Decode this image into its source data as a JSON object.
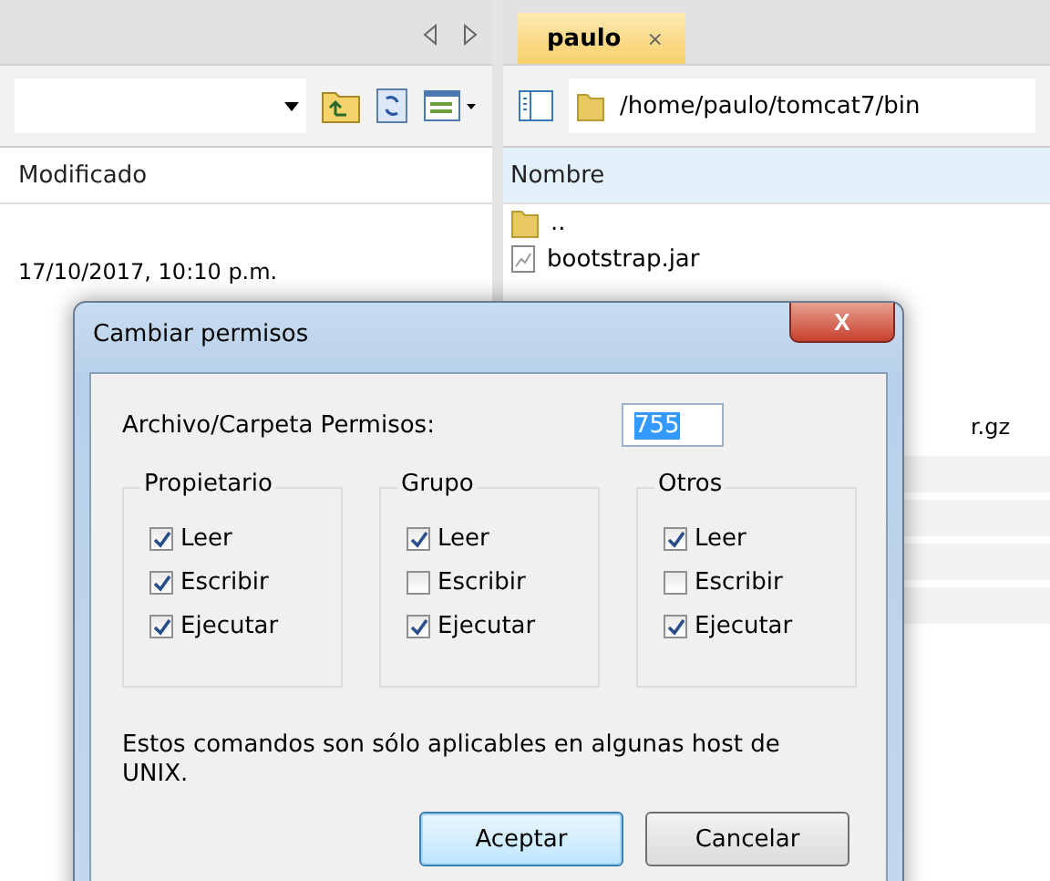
{
  "left_panel": {
    "column": "Modificado",
    "rows": [
      "17/10/2017, 10:10 p.m."
    ]
  },
  "right_panel": {
    "tabs": [
      {
        "label": "paulo",
        "close": "×",
        "selected": true
      }
    ],
    "path": "/home/paulo/tomcat7/bin",
    "column": "Nombre",
    "files": [
      {
        "name": "..",
        "kind": "folder"
      },
      {
        "name": "bootstrap.jar",
        "kind": "file"
      }
    ],
    "partial_name": "r.gz"
  },
  "dialog": {
    "title": "Cambiar permisos",
    "close": "X",
    "permissions_label": "Archivo/Carpeta Permisos:",
    "permissions_value": "755",
    "groups": [
      {
        "title": "Propietario",
        "options": [
          {
            "label": "Leer",
            "checked": true
          },
          {
            "label": "Escribir",
            "checked": true
          },
          {
            "label": "Ejecutar",
            "checked": true
          }
        ]
      },
      {
        "title": "Grupo",
        "options": [
          {
            "label": "Leer",
            "checked": true
          },
          {
            "label": "Escribir",
            "checked": false
          },
          {
            "label": "Ejecutar",
            "checked": true
          }
        ]
      },
      {
        "title": "Otros",
        "options": [
          {
            "label": "Leer",
            "checked": true
          },
          {
            "label": "Escribir",
            "checked": false
          },
          {
            "label": "Ejecutar",
            "checked": true
          }
        ]
      }
    ],
    "note": "Estos comandos son sólo aplicables en algunas host de UNIX.",
    "buttons": [
      {
        "label": "Aceptar",
        "default": true
      },
      {
        "label": "Cancelar",
        "default": false
      }
    ]
  }
}
